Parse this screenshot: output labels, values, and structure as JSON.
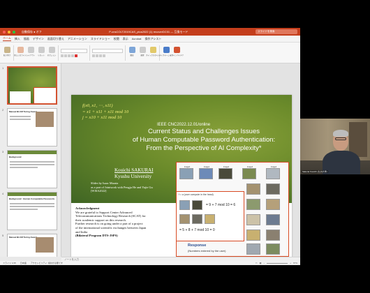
{
  "window": {
    "doc_title": "P-cnsCOLT2019CAS_plus2022 (1) recoverDC01 — 互換モード",
    "quick_access": "自動保存 ● オフ",
    "search_placeholder": "スライドを検索"
  },
  "ribbon_tabs": [
    "ホーム",
    "挿入",
    "描画",
    "デザイン",
    "画面切り替え",
    "アニメーション",
    "スライドショー",
    "校閲",
    "表示",
    "Acrobat",
    "操作アシスト"
  ],
  "ribbon_buttons": [
    "貼り付け",
    "新しいスライド",
    "レイアウト",
    "リセット",
    "セクション",
    "図形",
    "配置",
    "クイックスタイル",
    "ディクテーション",
    "デザインアイデア"
  ],
  "thumbnails": [
    {
      "num": "1",
      "title": ""
    },
    {
      "num": "2",
      "title": "Manuel BLUM Turing Award"
    },
    {
      "num": "3",
      "title": "Background"
    },
    {
      "num": "4",
      "title": "Background : Human Computable Passwords"
    },
    {
      "num": "5",
      "title": "Manuel BLUM Turing Award"
    }
  ],
  "slide": {
    "formula": [
      "f(x0, x1, ⋯, x11)",
      "= x1 + x11 + x11 mod 10",
      "j = x10 + x11 mod 10"
    ],
    "conference": "IEEE CNC2022.12.01/online",
    "title_lines": [
      "Current Status and Challenges Issues",
      "of Human Computable Password Authentication:",
      "From the Perspective of AI Complexity*"
    ],
    "author_name": "Kouichi SAKURAI",
    "affiliation": "Kyushu University",
    "slides_by_lines": [
      "Slides by Isaac Murata",
      "as a part of Jointwork with Pengju He and Yujie Gu",
      "[WISA2022]"
    ],
    "ack_heading": "Acknowledgment",
    "ack_lines": [
      "We are grateful to Support Center Advanced",
      "Telecommunications Technology Research (SCAT) for",
      "their academic support on this research.",
      "Further research is on going under a part of a project",
      "of the international scientific exchanges between Japan",
      "and India",
      "(Bilateral Program DTS-JSPS)"
    ],
    "calc_title": "f = a (user compute in the head)",
    "eq1": "= 9 + 7 mod 10 = 6",
    "eq2": "= 5 + 8 + 7 mod 10 = 0",
    "response_title": "Response",
    "response_sub": "(Numbers entered by the user)",
    "image_captions": [
      "Image0",
      "Image1",
      "Image2",
      "Image3",
      "Image4"
    ]
  },
  "notes_placeholder": "ノートを入力",
  "status": {
    "slide_count": "スライド 1/48",
    "language": "日本語",
    "accessibility": "アクセシビリティ: 検討が必要です",
    "zoom": "67%"
  },
  "webcam": {
    "name": "Sakurai Kouichi (九州大学)"
  },
  "colors": {
    "ppt_accent": "#c43e1c",
    "slide_green": "#6a8a2a",
    "formula_yellow": "#f3f07a",
    "box_border": "#d84a23",
    "response_blue": "#2c4d8f"
  }
}
